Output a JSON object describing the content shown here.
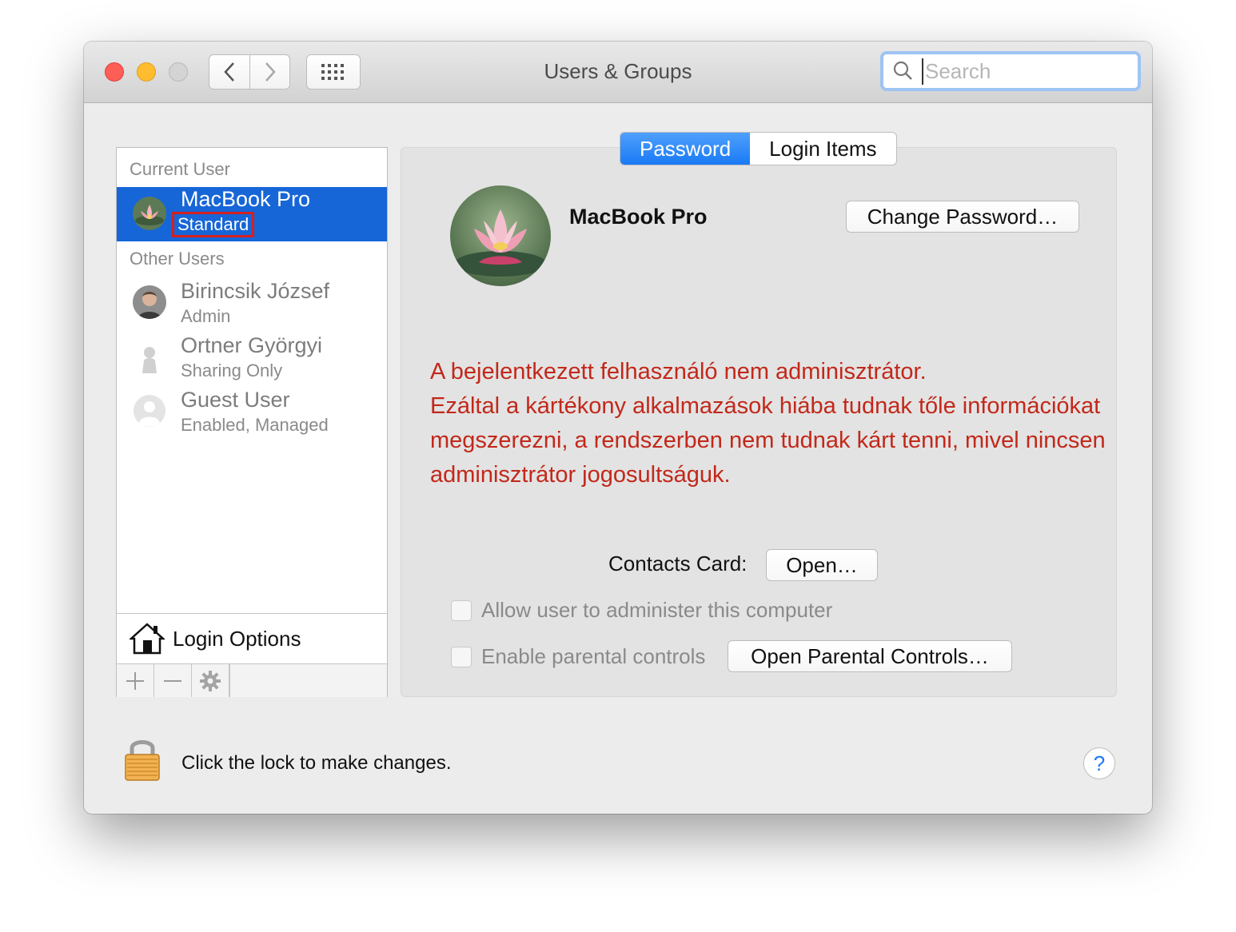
{
  "window": {
    "title": "Users & Groups"
  },
  "search": {
    "placeholder": "Search"
  },
  "sidebar": {
    "current_user_label": "Current User",
    "current_user": {
      "name": "MacBook Pro",
      "role": "Standard"
    },
    "other_users_label": "Other Users",
    "other_users": [
      {
        "name": "Birincsik József",
        "role": "Admin"
      },
      {
        "name": "Ortner Györgyi",
        "role": "Sharing Only"
      },
      {
        "name": "Guest User",
        "role": "Enabled, Managed"
      }
    ],
    "login_options": "Login Options",
    "toolbar": {
      "add": "+",
      "remove": "—"
    }
  },
  "tabs": [
    {
      "label": "Password",
      "active": true
    },
    {
      "label": "Login Items",
      "active": false
    }
  ],
  "main": {
    "user_name": "MacBook Pro",
    "change_password": "Change Password…",
    "notice_lines": [
      "A bejelentkezett felhasználó nem adminisztrátor.",
      "Ezáltal a kártékony alkalmazások hiába tudnak tőle információkat",
      "megszerezni, a rendszerben nem tudnak kárt tenni, mivel nincsen",
      "adminisztrátor jogosultságuk."
    ],
    "contacts_card_label": "Contacts Card:",
    "open_button": "Open…",
    "allow_admin_label": "Allow user to administer this computer",
    "allow_admin_checked": false,
    "parental_label": "Enable parental controls",
    "parental_checked": false,
    "open_parental_button": "Open Parental Controls…"
  },
  "footer": {
    "lock_text": "Click the lock to make changes.",
    "help": "?"
  },
  "colors": {
    "accent": "#1666d7",
    "notice": "#c2281a",
    "highlight_border": "#d62020"
  }
}
